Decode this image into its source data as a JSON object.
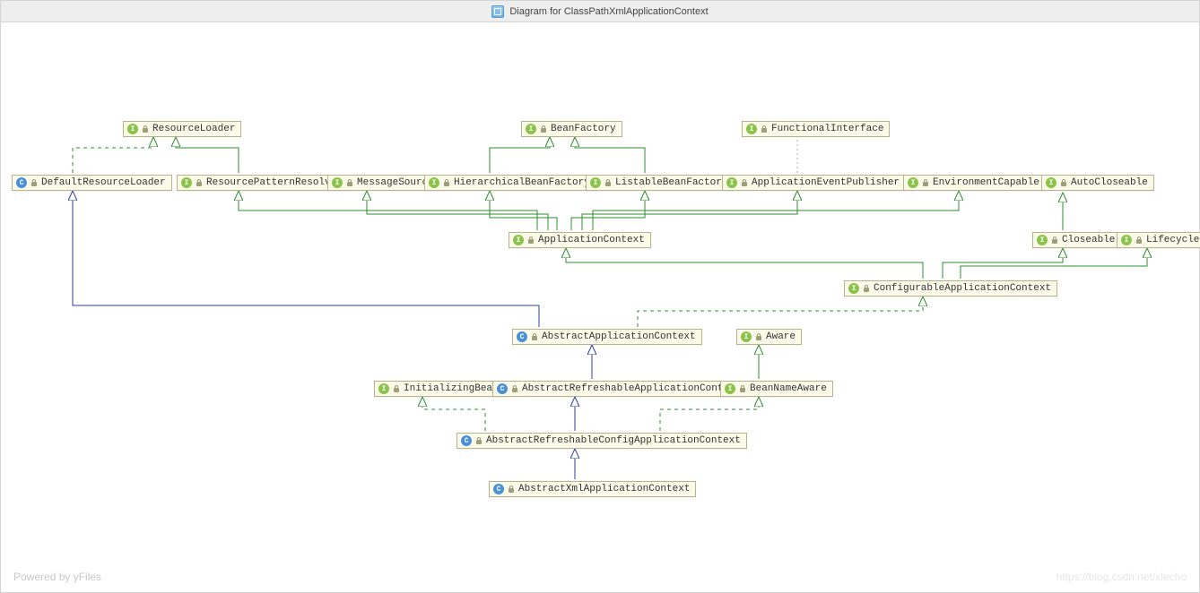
{
  "title": "Diagram for ClassPathXmlApplicationContext",
  "footer_left": "Powered by yFiles",
  "footer_right": "https://blog.csdn.net/xlecho",
  "node_types": {
    "I": "interface",
    "C": "class"
  },
  "nodes": {
    "ResourceLoader": {
      "type": "I",
      "label": "ResourceLoader"
    },
    "BeanFactory": {
      "type": "I",
      "label": "BeanFactory"
    },
    "FunctionalInterface": {
      "type": "I",
      "label": "FunctionalInterface"
    },
    "DefaultResourceLoader": {
      "type": "C",
      "label": "DefaultResourceLoader"
    },
    "ResourcePatternResolver": {
      "type": "I",
      "label": "ResourcePatternResolver"
    },
    "MessageSource": {
      "type": "I",
      "label": "MessageSource"
    },
    "HierarchicalBeanFactory": {
      "type": "I",
      "label": "HierarchicalBeanFactory"
    },
    "ListableBeanFactory": {
      "type": "I",
      "label": "ListableBeanFactory"
    },
    "ApplicationEventPublisher": {
      "type": "I",
      "label": "ApplicationEventPublisher"
    },
    "EnvironmentCapable": {
      "type": "I",
      "label": "EnvironmentCapable"
    },
    "AutoCloseable": {
      "type": "I",
      "label": "AutoCloseable"
    },
    "ApplicationContext": {
      "type": "I",
      "label": "ApplicationContext"
    },
    "Closeable": {
      "type": "I",
      "label": "Closeable"
    },
    "Lifecycle": {
      "type": "I",
      "label": "Lifecycle"
    },
    "ConfigurableApplicationContext": {
      "type": "I",
      "label": "ConfigurableApplicationContext"
    },
    "AbstractApplicationContext": {
      "type": "C",
      "label": "AbstractApplicationContext"
    },
    "Aware": {
      "type": "I",
      "label": "Aware"
    },
    "InitializingBean": {
      "type": "I",
      "label": "InitializingBean"
    },
    "AbstractRefreshableApplicationContext": {
      "type": "C",
      "label": "AbstractRefreshableApplicationContext"
    },
    "BeanNameAware": {
      "type": "I",
      "label": "BeanNameAware"
    },
    "AbstractRefreshableConfigApplicationContext": {
      "type": "C",
      "label": "AbstractRefreshableConfigApplicationContext"
    },
    "AbstractXmlApplicationContext": {
      "type": "C",
      "label": "AbstractXmlApplicationContext"
    }
  },
  "relations": [
    {
      "from": "DefaultResourceLoader",
      "to": "ResourceLoader",
      "style": "implements"
    },
    {
      "from": "ResourcePatternResolver",
      "to": "ResourceLoader",
      "style": "extends-interface"
    },
    {
      "from": "HierarchicalBeanFactory",
      "to": "BeanFactory",
      "style": "extends-interface"
    },
    {
      "from": "ListableBeanFactory",
      "to": "BeanFactory",
      "style": "extends-interface"
    },
    {
      "from": "ApplicationEventPublisher",
      "to": "FunctionalInterface",
      "style": "annotation"
    },
    {
      "from": "ApplicationContext",
      "to": "ResourcePatternResolver",
      "style": "extends-interface"
    },
    {
      "from": "ApplicationContext",
      "to": "MessageSource",
      "style": "extends-interface"
    },
    {
      "from": "ApplicationContext",
      "to": "HierarchicalBeanFactory",
      "style": "extends-interface"
    },
    {
      "from": "ApplicationContext",
      "to": "ListableBeanFactory",
      "style": "extends-interface"
    },
    {
      "from": "ApplicationContext",
      "to": "ApplicationEventPublisher",
      "style": "extends-interface"
    },
    {
      "from": "ApplicationContext",
      "to": "EnvironmentCapable",
      "style": "extends-interface"
    },
    {
      "from": "Closeable",
      "to": "AutoCloseable",
      "style": "extends-interface"
    },
    {
      "from": "ConfigurableApplicationContext",
      "to": "ApplicationContext",
      "style": "extends-interface"
    },
    {
      "from": "ConfigurableApplicationContext",
      "to": "Closeable",
      "style": "extends-interface"
    },
    {
      "from": "ConfigurableApplicationContext",
      "to": "Lifecycle",
      "style": "extends-interface"
    },
    {
      "from": "AbstractApplicationContext",
      "to": "DefaultResourceLoader",
      "style": "extends-class"
    },
    {
      "from": "AbstractApplicationContext",
      "to": "ConfigurableApplicationContext",
      "style": "implements"
    },
    {
      "from": "AbstractRefreshableApplicationContext",
      "to": "AbstractApplicationContext",
      "style": "extends-class"
    },
    {
      "from": "BeanNameAware",
      "to": "Aware",
      "style": "extends-interface"
    },
    {
      "from": "AbstractRefreshableConfigApplicationContext",
      "to": "InitializingBean",
      "style": "implements"
    },
    {
      "from": "AbstractRefreshableConfigApplicationContext",
      "to": "AbstractRefreshableApplicationContext",
      "style": "extends-class"
    },
    {
      "from": "AbstractRefreshableConfigApplicationContext",
      "to": "BeanNameAware",
      "style": "implements"
    },
    {
      "from": "AbstractXmlApplicationContext",
      "to": "AbstractRefreshableConfigApplicationContext",
      "style": "extends-class"
    }
  ],
  "arrow_styles": {
    "extends-class": {
      "color": "#2f3f9a",
      "dash": "none",
      "head": "hollow"
    },
    "extends-interface": {
      "color": "#2e8b2e",
      "dash": "none",
      "head": "hollow"
    },
    "implements": {
      "color": "#2e8b2e",
      "dash": "4,4",
      "head": "hollow"
    },
    "annotation": {
      "color": "#b6b08f",
      "dash": "2,3",
      "head": "none"
    }
  }
}
